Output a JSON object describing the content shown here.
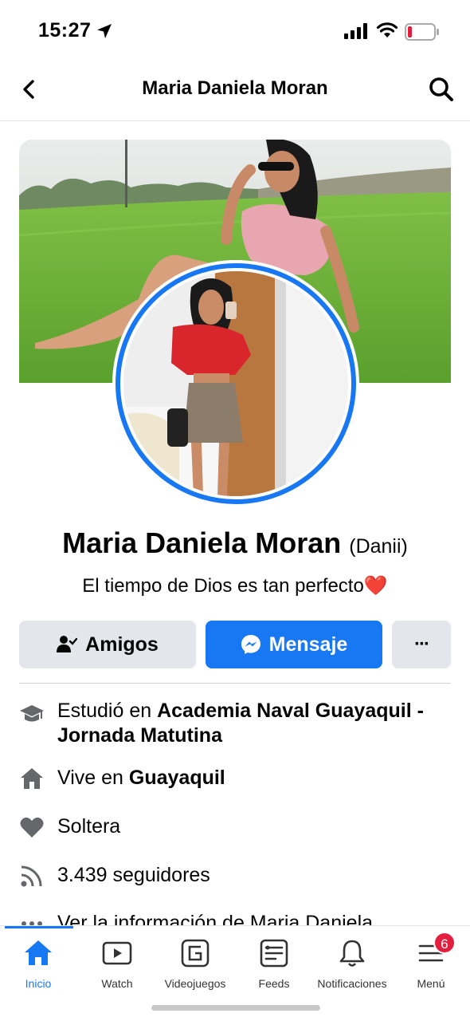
{
  "status_bar": {
    "time": "15:27"
  },
  "header": {
    "title": "Maria Daniela Moran"
  },
  "profile": {
    "name": "Maria Daniela Moran",
    "nickname": "(Danii)",
    "bio": "El tiempo de Dios es tan perfecto❤️"
  },
  "actions": {
    "friends_label": "Amigos",
    "message_label": "Mensaje",
    "more_label": "···"
  },
  "intro": {
    "education_prefix": "Estudió en ",
    "education_line1": "Academia Naval Guayaquil -",
    "education_line2": "Jornada Matutina",
    "lives_prefix": "Vive en ",
    "lives_city": "Guayaquil",
    "relationship": "Soltera",
    "followers": "3.439 seguidores",
    "see_info": "Ver la información de Maria Daniela"
  },
  "tabs": [
    {
      "label": "Inicio",
      "icon": "home-icon",
      "active": true
    },
    {
      "label": "Watch",
      "icon": "watch-icon"
    },
    {
      "label": "Videojuegos",
      "icon": "gaming-icon"
    },
    {
      "label": "Feeds",
      "icon": "feeds-icon"
    },
    {
      "label": "Notificaciones",
      "icon": "bell-icon"
    },
    {
      "label": "Menú",
      "icon": "menu-icon"
    }
  ],
  "menu_badge": "6",
  "colors": {
    "accent": "#1877f2",
    "button_gray": "#e4e6eb",
    "badge_red": "#e41e3f"
  }
}
